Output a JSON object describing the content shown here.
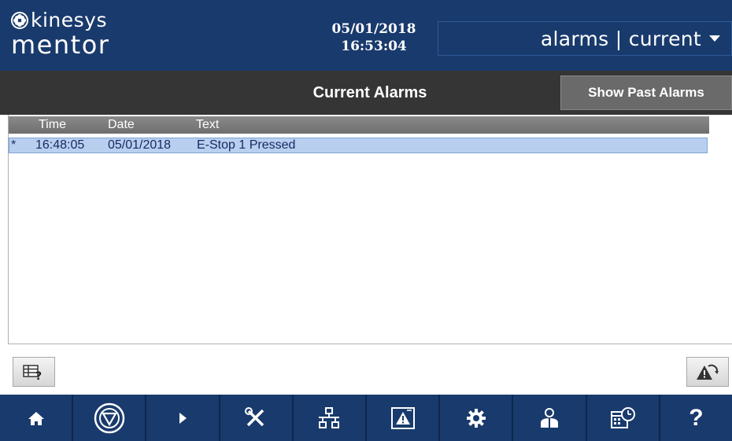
{
  "brand": {
    "logo_top": "kinesys",
    "logo_bottom": "mentor"
  },
  "clock": {
    "date": "05/01/2018",
    "time": "16:53:04"
  },
  "mode_selector": {
    "label": "alarms | current"
  },
  "title_bar": {
    "title": "Current Alarms",
    "past_button_label": "Show Past Alarms"
  },
  "alarm_table": {
    "columns": [
      "Time",
      "Date",
      "Text"
    ],
    "rows": [
      {
        "marker": "*",
        "time": "16:48:05",
        "date": "05/01/2018",
        "text": "E-Stop 1 Pressed",
        "selected": true
      }
    ]
  },
  "colors": {
    "header_bg": "#193a6c",
    "titlebar_bg": "#353535",
    "selected_row_bg": "#b8cff0",
    "table_header_bg": "#7a7a7a"
  },
  "nav": {
    "items": [
      {
        "icon": "home-icon"
      },
      {
        "icon": "estop-icon"
      },
      {
        "icon": "play-icon"
      },
      {
        "icon": "tools-icon"
      },
      {
        "icon": "network-icon"
      },
      {
        "icon": "alarm-warning-icon"
      },
      {
        "icon": "gear-icon"
      },
      {
        "icon": "user-icon"
      },
      {
        "icon": "schedule-icon"
      },
      {
        "icon": "help-icon",
        "label": "?"
      }
    ]
  }
}
